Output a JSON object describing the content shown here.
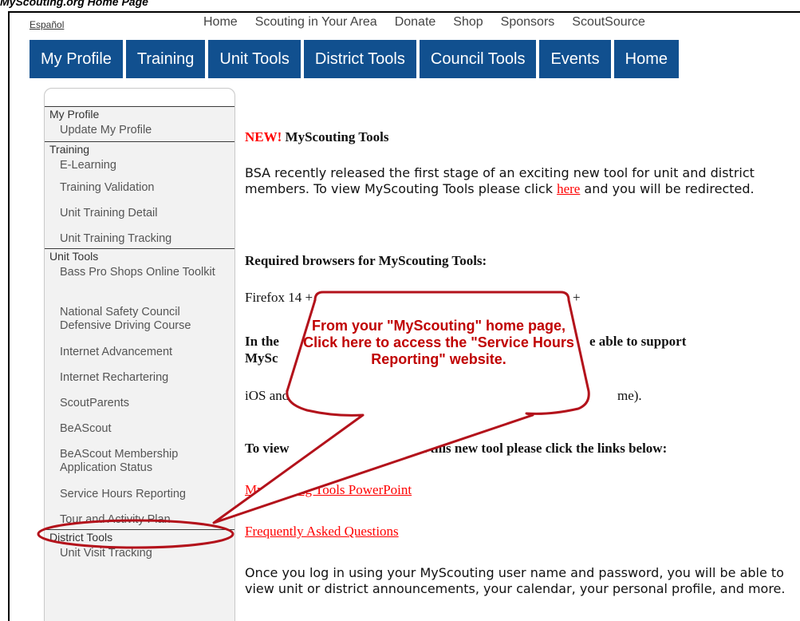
{
  "caption": "MyScouting.org Home Page",
  "util": {
    "lang": "Español",
    "links": [
      "Home",
      "Scouting in Your Area",
      "Donate",
      "Shop",
      "Sponsors",
      "ScoutSource"
    ]
  },
  "nav": {
    "tabs": [
      "My Profile",
      "Training",
      "Unit Tools",
      "District Tools",
      "Council Tools",
      "Events",
      "Home"
    ]
  },
  "sidebar": {
    "sections": [
      {
        "title": "My Profile",
        "items": [
          "Update My Profile"
        ]
      },
      {
        "title": "Training",
        "items": [
          "E-Learning",
          "Training Validation",
          "Unit Training Detail",
          "Unit Training Tracking"
        ]
      },
      {
        "title": "Unit Tools",
        "items": [
          "Bass Pro Shops Online Toolkit",
          "National Safety Council Defensive Driving Course",
          "Internet Advancement",
          "Internet Rechartering",
          "ScoutParents",
          "BeAScout",
          "BeAScout Membership Application Status",
          "Service Hours Reporting",
          "Tour and Activity Plan"
        ]
      },
      {
        "title": "District Tools",
        "items": [
          "Unit Visit Tracking"
        ]
      }
    ]
  },
  "content": {
    "new_label": "NEW!",
    "heading": "MyScouting Tools",
    "intro_before": "BSA recently released the first stage of an exciting new tool for unit and district members. To view MyScouting Tools please click ",
    "intro_link": "here",
    "intro_after": " and you will be redirected.",
    "required_heading": "Required browsers for MyScouting Tools:",
    "browsers": "Firefox 14 +, Google Chrome 21 +, or Internet Explorer 9.0 +",
    "mobile_left": "In the",
    "mobile_right": "e able to support",
    "mobile_line2": "MySc",
    "ios_left": "iOS and",
    "ios_right": "me).",
    "view_left": "To view",
    "view_right": "on this new tool please click the links below:",
    "link_powerpoint": "MyScouting Tools PowerPoint",
    "link_faq": "Frequently Asked Questions",
    "closing": "Once you log in using your MyScouting user name and password, you will be able to view unit or district announcements, your calendar, your personal profile, and more."
  },
  "callout": {
    "text": "From your \"MyScouting\" home page, Click here to access the \"Service Hours Reporting\" website."
  }
}
